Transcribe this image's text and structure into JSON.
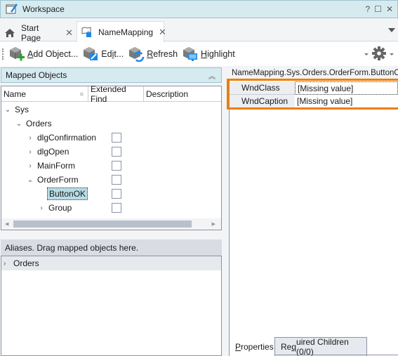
{
  "window": {
    "title": "Workspace",
    "controls": {
      "help": "?",
      "maximize": "☐",
      "close": "✕"
    }
  },
  "tabs": [
    {
      "label": "Start Page",
      "icon": "home-icon",
      "close": "✕",
      "active": false
    },
    {
      "label": "NameMapping",
      "icon": "name-mapping-icon",
      "close": "✕",
      "active": true
    }
  ],
  "toolbar": {
    "buttons": [
      {
        "label_prefix": "",
        "mnemonic": "A",
        "label_rest": "dd Object...",
        "icon": "add-object-icon"
      },
      {
        "label_prefix": "Ed",
        "mnemonic": "i",
        "label_rest": "t...",
        "icon": "edit-icon"
      },
      {
        "label_prefix": "",
        "mnemonic": "R",
        "label_rest": "efresh",
        "icon": "refresh-icon"
      },
      {
        "label_prefix": "",
        "mnemonic": "H",
        "label_rest": "ighlight",
        "icon": "highlight-icon"
      }
    ],
    "settings_icon": "gear-icon"
  },
  "mapped_objects": {
    "header": "Mapped Objects",
    "collapse_glyph": "︽",
    "columns": [
      "Name",
      "Extended Find",
      "Description"
    ],
    "sort_glyph": "≡",
    "rows": [
      {
        "label": "Sys",
        "expander": "⌄",
        "has_checkbox": false,
        "selected": false
      },
      {
        "label": "Orders",
        "expander": "⌄",
        "has_checkbox": false,
        "selected": false
      },
      {
        "label": "dlgConfirmation",
        "expander": "›",
        "has_checkbox": true,
        "checked": false,
        "selected": false
      },
      {
        "label": "dlgOpen",
        "expander": "›",
        "has_checkbox": true,
        "checked": false,
        "selected": false
      },
      {
        "label": "MainForm",
        "expander": "›",
        "has_checkbox": true,
        "checked": false,
        "selected": false
      },
      {
        "label": "OrderForm",
        "expander": "⌄",
        "has_checkbox": true,
        "checked": false,
        "selected": false
      },
      {
        "label": "ButtonOK",
        "expander": "",
        "has_checkbox": true,
        "checked": false,
        "selected": true
      },
      {
        "label": "Group",
        "expander": "›",
        "has_checkbox": true,
        "checked": false,
        "selected": false
      }
    ]
  },
  "aliases": {
    "header": "Aliases. Drag mapped objects here.",
    "rows": [
      {
        "label": "Orders",
        "expander": "›"
      }
    ]
  },
  "properties": {
    "path": "NameMapping.Sys.Orders.OrderForm.ButtonOK",
    "rows": [
      {
        "name": "WndClass",
        "value": "[Missing value]"
      },
      {
        "name": "WndCaption",
        "value": "[Missing value]"
      }
    ],
    "highlight_color": "#f07d00",
    "tabs": [
      {
        "mnemonic": "P",
        "rest": "roperties",
        "active": true
      },
      {
        "prefix": "Re",
        "mnemonic": "q",
        "rest": "uired Children (0/0)",
        "active": false
      }
    ]
  }
}
